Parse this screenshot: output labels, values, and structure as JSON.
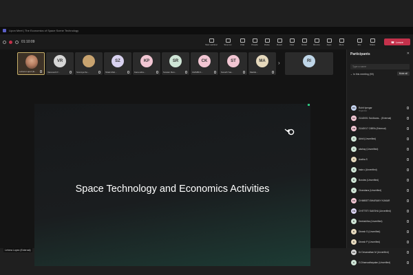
{
  "window": {
    "title": "Lipon Meet | The Economics of Space Scene Technology"
  },
  "toolbar": {
    "timer": "01:10:09",
    "tools": [
      "Chat",
      "People",
      "Raise",
      "React",
      "View",
      "Notes",
      "Rooms",
      "Apps",
      "More"
    ],
    "first_tools": [
      "Start webinar",
      "Stop rec"
    ],
    "right_tools": [
      "Mic",
      "Share"
    ],
    "leave_label": "Leave"
  },
  "strip": {
    "tiles": [
      {
        "initials": "",
        "name": "Lehera Lopez (E...",
        "color": "#3c3126"
      },
      {
        "initials": "VR",
        "name": "Varenesh P...",
        "color": "#d6d6d6"
      },
      {
        "initials": "",
        "name": "Sowmya So...",
        "color": "#c8a36f"
      },
      {
        "initials": "SZ",
        "name": "Shaik Mob...",
        "color": "#d9d2f0"
      },
      {
        "initials": "KP",
        "name": "Kamendra...",
        "color": "#f2c6d3"
      },
      {
        "initials": "SR",
        "name": "Suvtam Ran...",
        "color": "#cfe5d6"
      },
      {
        "initials": "CK",
        "name": "CHIMBI K...",
        "color": "#f2c6d3"
      },
      {
        "initials": "ST",
        "name": "Sonath Yas...",
        "color": "#f2c6d3"
      },
      {
        "initials": "MA",
        "name": "Madds...",
        "color": "#e6d9bd"
      }
    ],
    "extra": {
      "initials": "RI",
      "color": "#bfd6e8"
    }
  },
  "share": {
    "title": "Space Technology and Economics Activities",
    "presenter": "Lehera Lopez (External)"
  },
  "panel": {
    "title": "Participants",
    "search_placeholder": "Type a name",
    "section_label": "In this meeting (99)",
    "mute_all_label": "Mute all",
    "organizer_role": "Organizer",
    "people": [
      {
        "initials": "RS",
        "name": "Rohit Iyengar",
        "color": "#c5d3ef"
      },
      {
        "initials": "SA",
        "name": "21AD001 Sai Akans... (External)",
        "color": "#f2c6d3"
      },
      {
        "initials": "CB",
        "name": "21AD017 CIBRA (External)",
        "color": "#f2c6d3"
      },
      {
        "initials": "A",
        "name": "Abhil (Unverified)",
        "color": "#cfe5d6"
      },
      {
        "initials": "A",
        "name": "akshay (Unverified)",
        "color": "#cfe5d6"
      },
      {
        "initials": "A",
        "name": "Aratha S",
        "color": "#e6d9bd"
      },
      {
        "initials": "B",
        "name": "bala s (Unverified)",
        "color": "#cfe5d6"
      },
      {
        "initials": "B",
        "name": "Bondes (Unverified)",
        "color": "#cfe5d6"
      },
      {
        "initials": "C",
        "name": "Chandana (Unverified)",
        "color": "#cfe5d6"
      },
      {
        "initials": "CK",
        "name": "CHIMBETI BHARANY KUMAR",
        "color": "#f2c6d3"
      },
      {
        "initials": "CN",
        "name": "CHITTETI SAKSHA (Unverified)",
        "color": "#d9d2f0"
      },
      {
        "initials": "D",
        "name": "Deekshitha (Unverified)",
        "color": "#cfe5d6"
      },
      {
        "initials": "D",
        "name": "Dinesh S (Unverified)",
        "color": "#e6d9bd"
      },
      {
        "initials": "D",
        "name": "Dinesh P (Unverified)",
        "color": "#e6d9bd"
      },
      {
        "initials": "DD",
        "name": "Dr Devanathan M (Unverified)",
        "color": "#d6d6d6"
      },
      {
        "initials": "G",
        "name": "G.Dhanvadhayalan (Unverified)",
        "color": "#cfe5d6"
      }
    ]
  }
}
